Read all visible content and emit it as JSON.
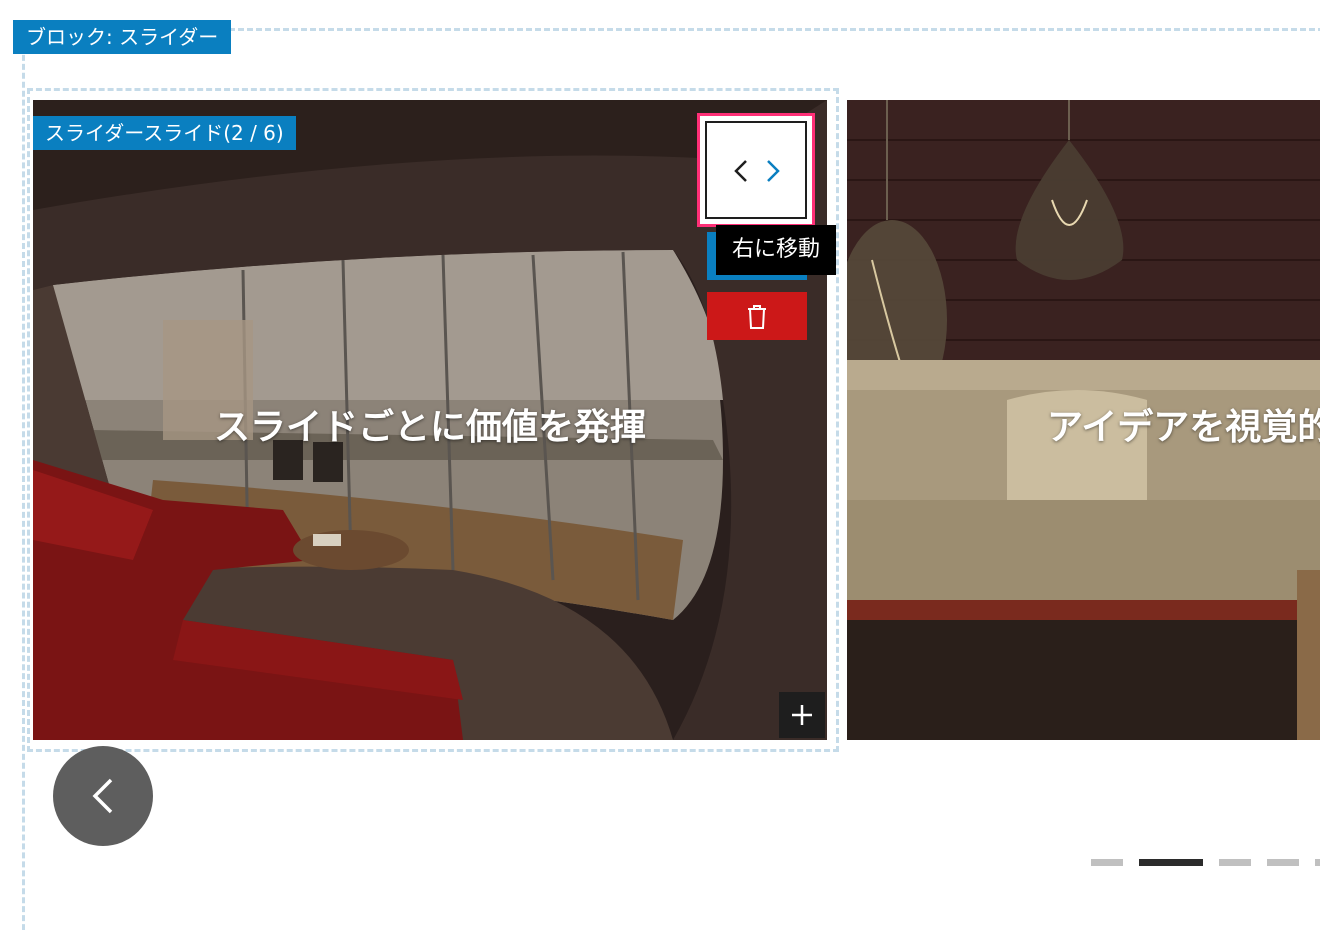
{
  "block": {
    "label": "ブロック: スライダー"
  },
  "slide_editor": {
    "label": "スライダースライド(2 / 6)",
    "tooltip": "右に移動"
  },
  "slides": [
    {
      "heading": "スライドごとに価値を発揮"
    },
    {
      "heading": "アイデアを視覚的"
    }
  ],
  "pagination": {
    "total": 5,
    "active_index": 1
  },
  "colors": {
    "accent": "#0a7fc0",
    "highlight": "#ff2f77",
    "danger": "#cc1818",
    "dark": "#1e1e1e"
  },
  "icons": {
    "move_left": "chevron-left-icon",
    "move_right": "chevron-right-icon",
    "delete": "trash-icon",
    "add": "plus-icon",
    "prev": "chevron-left-icon"
  }
}
